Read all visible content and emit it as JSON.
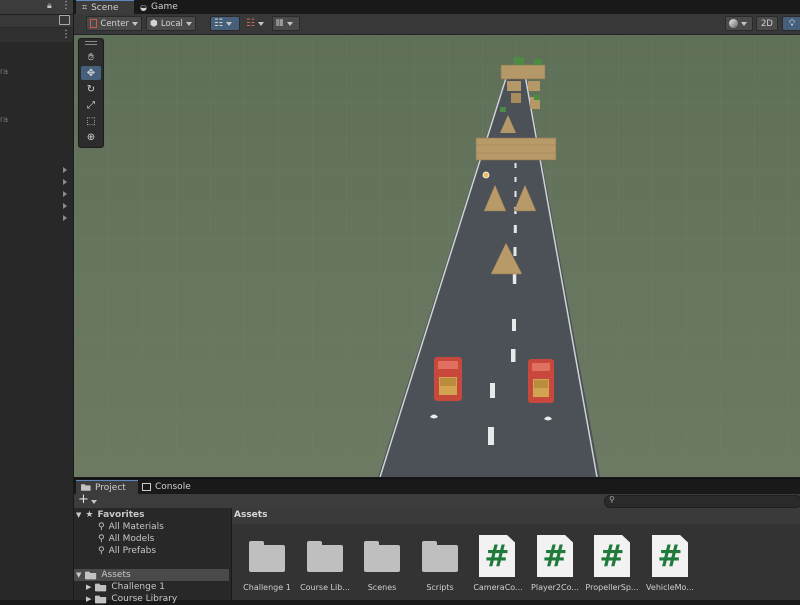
{
  "hierarchy": {
    "labels": [
      "nera",
      "er",
      "nera",
      "er"
    ]
  },
  "tabs": [
    {
      "label": "Scene",
      "icon": "grid-icon"
    },
    {
      "label": "Game",
      "icon": "gamepad-icon"
    }
  ],
  "toolbar": {
    "pivot_label": "Center",
    "space_label": "Local",
    "mode_2d": "2D"
  },
  "bottom_tabs": [
    {
      "label": "Project",
      "icon": "folder-icon"
    },
    {
      "label": "Console",
      "icon": "console-icon"
    }
  ],
  "project": {
    "add_label": "+",
    "tree": {
      "favorites": {
        "label": "Favorites",
        "items": [
          "All Materials",
          "All Models",
          "All Prefabs"
        ]
      },
      "assets": {
        "label": "Assets",
        "items": [
          "Challenge 1",
          "Course Library"
        ]
      }
    },
    "breadcrumb": "Assets",
    "items": [
      {
        "label": "Challenge 1",
        "type": "folder"
      },
      {
        "label": "Course Lib...",
        "type": "folder"
      },
      {
        "label": "Scenes",
        "type": "folder"
      },
      {
        "label": "Scripts",
        "type": "folder"
      },
      {
        "label": "CameraCo...",
        "type": "script"
      },
      {
        "label": "Player2Co...",
        "type": "script"
      },
      {
        "label": "PropellerSp...",
        "type": "script"
      },
      {
        "label": "VehicleMo...",
        "type": "script"
      }
    ],
    "script_glyph": "#"
  },
  "colors": {
    "ground": "#66745c",
    "road": "#4b5157",
    "accent": "#46607c",
    "vehicle": "#c8483c",
    "crate": "#b89a68"
  }
}
